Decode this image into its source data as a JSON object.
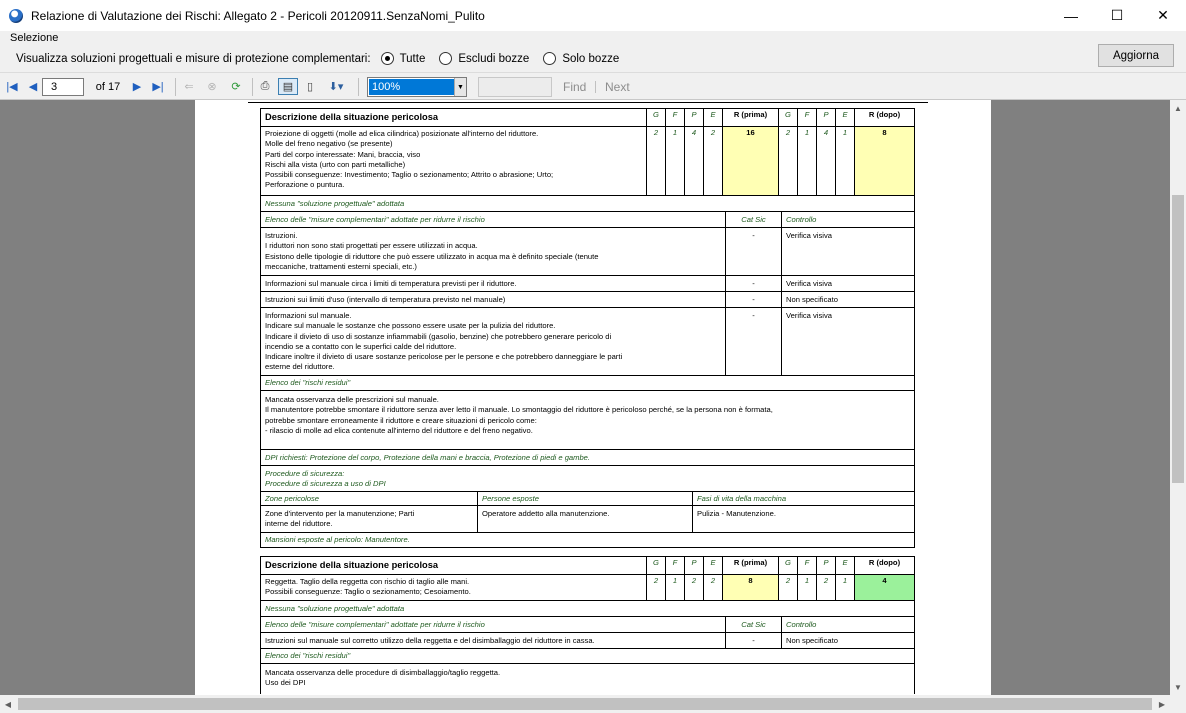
{
  "window": {
    "title": "Relazione di Valutazione dei Rischi: Allegato 2 - Pericoli 20120911.SenzaNomi_Pulito",
    "minimize": "—",
    "maximize": "☐",
    "close": "✕"
  },
  "menu": {
    "selezione": "Selezione"
  },
  "filter": {
    "label": "Visualizza soluzioni progettuali e misure di protezione complementari:",
    "options": [
      "Tutte",
      "Escludi bozze",
      "Solo bozze"
    ],
    "selected": "Tutte",
    "refresh_label": "Aggiorna"
  },
  "toolbar": {
    "current_page": "3",
    "page_of": "of 17",
    "zoom": "100%",
    "find_value": "",
    "find_label": "Find",
    "next_label": "Next"
  },
  "report": {
    "headers": {
      "descrizione": "Descrizione della situazione pericolosa",
      "g": "G",
      "f": "F",
      "p": "P",
      "e": "E",
      "r_prima": "R (prima)",
      "r_dopo": "R (dopo)",
      "elenco_misure": "Elenco delle \"misure complementari\" adottate per ridurre il rischio",
      "cat_sic": "Cat Sic",
      "controllo": "Controllo",
      "rischi_residui": "Elenco dei \"rischi residui\"",
      "zone": "Zone pericolose",
      "persone": "Persone esposte",
      "fasi": "Fasi di vita della macchina"
    },
    "hazard1": {
      "description": [
        "Proiezione di oggetti (molle ad elica cilindrica) posizionate all'interno del riduttore.",
        "Molle del freno negativo (se presente)",
        "Parti del corpo interessate: Mani, braccia, viso",
        "Rischi alla vista (urto con parti metalliche)",
        "Possibili conseguenze: Investimento; Taglio o sezionamento; Attrito o abrasione; Urto;",
        "Perforazione o puntura."
      ],
      "g1": "2",
      "f1": "1",
      "p1": "4",
      "e1": "2",
      "r_prima": "16",
      "g2": "2",
      "f2": "1",
      "p2": "4",
      "e2": "1",
      "r_dopo": "8",
      "no_solution": "Nessuna \"soluzione progettuale\" adottata",
      "measures": [
        {
          "text": [
            "Istruzioni.",
            "I riduttori non sono stati progettati per essere utilizzati in acqua.",
            "Esistono delle tipologie di riduttore che può essere utilizzato in acqua ma è definito speciale (tenute",
            "meccaniche, trattamenti esterni speciali, etc.)"
          ],
          "cat": "-",
          "ctrl": "Verifica visiva"
        },
        {
          "text": [
            "Informazioni sul manuale circa i limiti di temperatura previsti per il riduttore."
          ],
          "cat": "-",
          "ctrl": "Verifica visiva"
        },
        {
          "text": [
            "Istruzioni sui limiti d'uso (intervallo di temperatura previsto nel manuale)"
          ],
          "cat": "-",
          "ctrl": "Non specificato"
        },
        {
          "text": [
            "Informazioni sul manuale.",
            "Indicare sul manuale le sostanze che possono essere usate per la pulizia del riduttore.",
            "Indicare il divieto di uso di sostanze infiammabili (gasolio, benzine) che potrebbero generare pericolo di",
            "incendio se a contatto con le superfici calde del riduttore.",
            "Indicare inoltre il divieto di usare sostanze pericolose per le persone e che potrebbero danneggiare le parti",
            "esterne del riduttore."
          ],
          "cat": "-",
          "ctrl": "Verifica visiva"
        }
      ],
      "residual": [
        "Mancata osservanza delle prescrizioni sul manuale.",
        "Il manutentore potrebbe smontare il riduttore senza aver letto il manuale. Lo smontaggio del riduttore è pericoloso perché, se la persona non è formata,",
        "potrebbe smontare erroneamente il riduttore e creare situazioni di pericolo come:",
        "- rilascio di molle ad elica contenute all'interno del riduttore e del freno negativo."
      ],
      "dpi": "DPI richiesti: Protezione del corpo, Protezione della mani e braccia, Protezione di piedi e gambe.",
      "procedure": [
        "Procedure di sicurezza:",
        "Procedure di sicurezza a uso di DPI"
      ],
      "zone_text": [
        "Zone d'intervento per la manutenzione; Parti",
        "interne del riduttore."
      ],
      "persone_text": "Operatore addetto alla manutenzione.",
      "fasi_text": "Pulizia - Manutenzione.",
      "mansioni": "Mansioni esposte al pericolo: Manutentore."
    },
    "hazard2": {
      "description": [
        "Reggetta. Taglio della reggetta con rischio di taglio alle mani.",
        "Possibili conseguenze: Taglio o sezionamento; Cesoiamento."
      ],
      "g1": "2",
      "f1": "1",
      "p1": "2",
      "e1": "2",
      "r_prima": "8",
      "g2": "2",
      "f2": "1",
      "p2": "2",
      "e2": "1",
      "r_dopo": "4",
      "no_solution": "Nessuna \"soluzione progettuale\" adottata",
      "measure_text": "Istruzioni sul manuale sul corretto utilizzo della reggetta e del disimballaggio del riduttore in cassa.",
      "measure_cat": "-",
      "measure_ctrl": "Non specificato",
      "residual": [
        "Mancata osservanza delle procedure di disimballaggio/taglio reggetta.",
        "Uso dei DPI"
      ]
    }
  }
}
